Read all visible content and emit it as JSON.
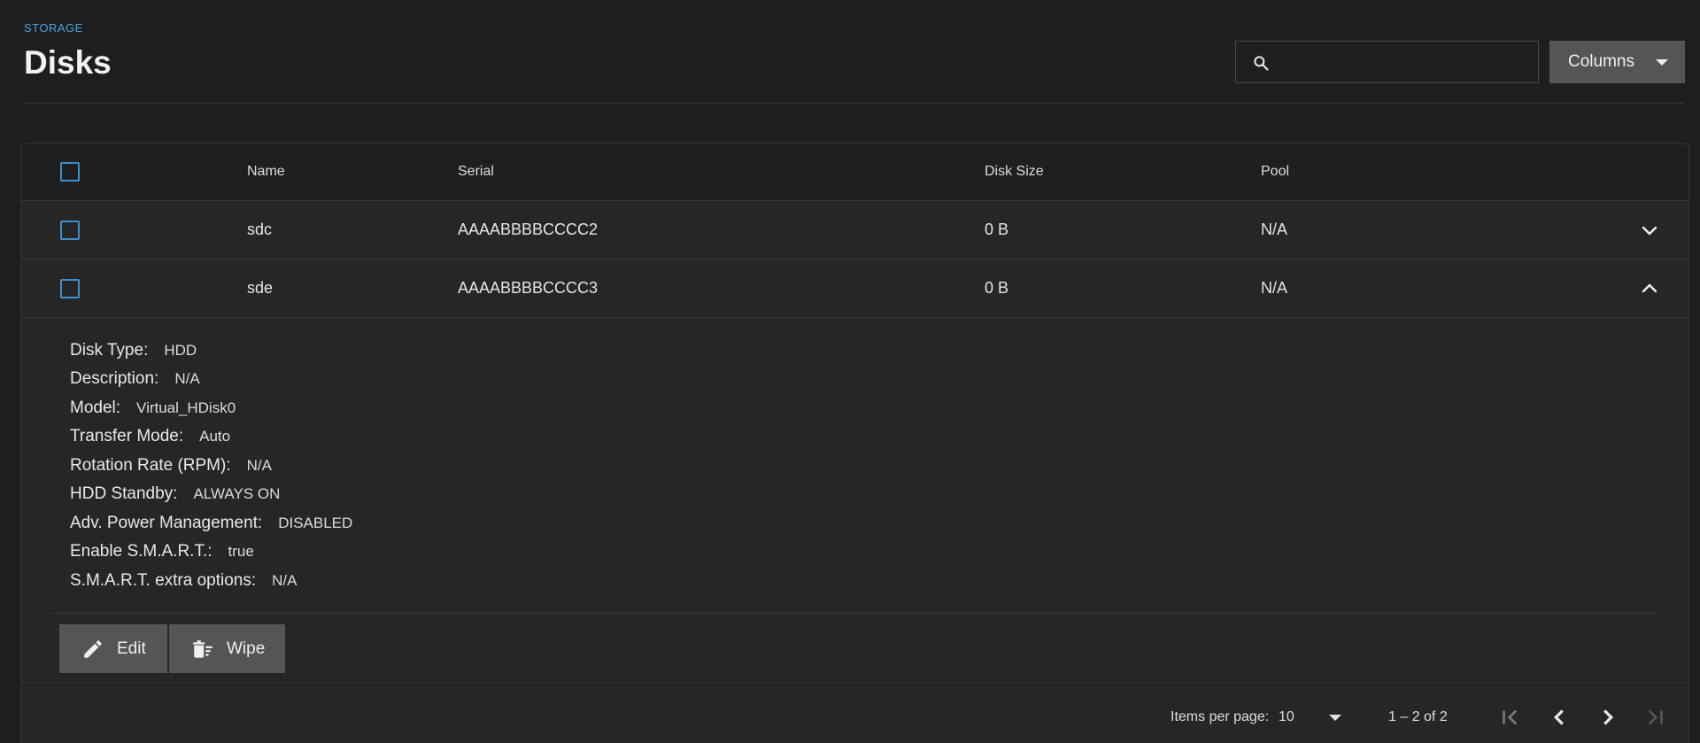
{
  "header": {
    "breadcrumb": "STORAGE",
    "title": "Disks",
    "search": {
      "value": "",
      "placeholder": ""
    },
    "columns_label": "Columns"
  },
  "table": {
    "columns": [
      "Name",
      "Serial",
      "Disk Size",
      "Pool"
    ],
    "rows": [
      {
        "name": "sdc",
        "serial": "AAAABBBBCCCC2",
        "size": "0 B",
        "pool": "N/A",
        "expanded": false
      },
      {
        "name": "sde",
        "serial": "AAAABBBBCCCC3",
        "size": "0 B",
        "pool": "N/A",
        "expanded": true
      }
    ]
  },
  "details": [
    {
      "label": "Disk Type:",
      "value": "HDD"
    },
    {
      "label": "Description:",
      "value": "N/A"
    },
    {
      "label": "Model:",
      "value": "Virtual_HDisk0"
    },
    {
      "label": "Transfer Mode:",
      "value": "Auto"
    },
    {
      "label": "Rotation Rate (RPM):",
      "value": "N/A"
    },
    {
      "label": "HDD Standby:",
      "value": "ALWAYS ON"
    },
    {
      "label": "Adv. Power Management:",
      "value": "DISABLED"
    },
    {
      "label": "Enable S.M.A.R.T.:",
      "value": "true"
    },
    {
      "label": "S.M.A.R.T. extra options:",
      "value": "N/A"
    }
  ],
  "actions": {
    "edit_label": "Edit",
    "wipe_label": "Wipe"
  },
  "paginator": {
    "items_per_page_label": "Items per page:",
    "items_per_page": "10",
    "range": "1 – 2 of 2"
  },
  "icons": {
    "search": "search-icon",
    "expand": "chevron-down-icon",
    "collapse": "chevron-up-icon",
    "edit": "pencil-icon",
    "wipe": "trash-icon"
  },
  "colors": {
    "accent": "#4ea5e0",
    "checkbox": "#3d8fd1",
    "button": "#555555"
  }
}
